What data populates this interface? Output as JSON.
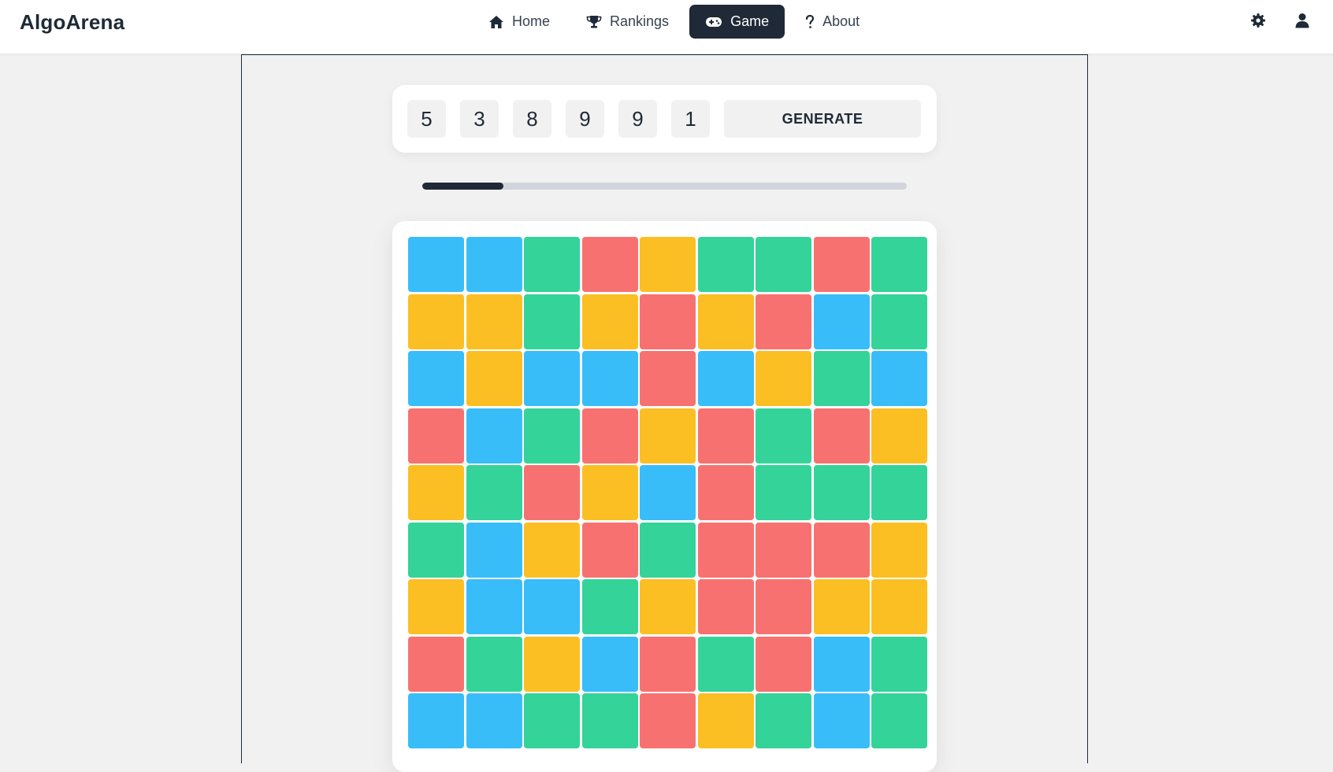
{
  "app": {
    "title": "AlgoArena"
  },
  "nav": {
    "links": [
      {
        "label": "Home",
        "icon": "home-icon",
        "active": false
      },
      {
        "label": "Rankings",
        "icon": "trophy-icon",
        "active": false
      },
      {
        "label": "Game",
        "icon": "gamepad-icon",
        "active": true
      },
      {
        "label": "About",
        "icon": "question-icon",
        "active": false
      }
    ],
    "right_icons": [
      "gear-icon",
      "user-icon"
    ]
  },
  "seed": {
    "digits": [
      "5",
      "3",
      "8",
      "9",
      "9",
      "1"
    ],
    "generate_label": "GENERATE"
  },
  "progress": {
    "fraction": 0.167
  },
  "colors": {
    "B": "#38bdf8",
    "G": "#34d399",
    "R": "#f87171",
    "Y": "#fbbf24"
  },
  "board": {
    "rows": [
      [
        "B",
        "B",
        "G",
        "R",
        "Y",
        "G",
        "G",
        "R",
        "G"
      ],
      [
        "Y",
        "Y",
        "G",
        "Y",
        "R",
        "Y",
        "R",
        "B",
        "G"
      ],
      [
        "B",
        "Y",
        "B",
        "B",
        "R",
        "B",
        "Y",
        "G",
        "B"
      ],
      [
        "R",
        "B",
        "G",
        "R",
        "Y",
        "R",
        "G",
        "R",
        "Y"
      ],
      [
        "Y",
        "G",
        "R",
        "Y",
        "B",
        "R",
        "G",
        "G",
        "G"
      ],
      [
        "G",
        "B",
        "Y",
        "R",
        "G",
        "R",
        "R",
        "R",
        "Y"
      ],
      [
        "Y",
        "B",
        "B",
        "G",
        "Y",
        "R",
        "R",
        "Y",
        "Y"
      ],
      [
        "R",
        "G",
        "Y",
        "B",
        "R",
        "G",
        "R",
        "B",
        "G"
      ],
      [
        "B",
        "B",
        "G",
        "G",
        "R",
        "Y",
        "G",
        "B",
        "G"
      ]
    ]
  }
}
